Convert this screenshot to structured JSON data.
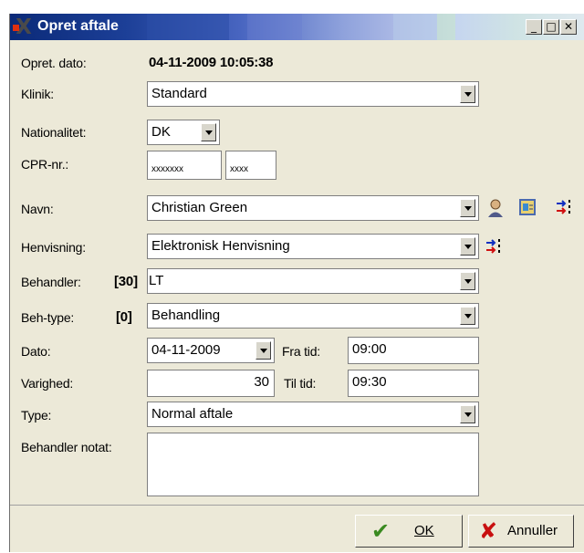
{
  "window": {
    "title": "Opret aftale"
  },
  "labels": {
    "created_date": "Opret. dato:",
    "clinic": "Klinik:",
    "nationality": "Nationalitet:",
    "cpr": "CPR-nr.:",
    "name": "Navn:",
    "referral": "Henvisning:",
    "practitioner": "Behandler:",
    "practitioner_code": "[30]",
    "treatment_type": "Beh-type:",
    "treatment_type_code": "[0]",
    "date": "Dato:",
    "from_time": "Fra tid:",
    "duration": "Varighed:",
    "to_time": "Til tid:",
    "type": "Type:",
    "practitioner_note": "Behandler notat:"
  },
  "values": {
    "created_date": "04-11-2009 10:05:38",
    "clinic": "Standard",
    "nationality": "DK",
    "cpr_first": "xxxxxxx",
    "cpr_second": "xxxx",
    "name": "Christian Green",
    "referral": "Elektronisk Henvisning",
    "practitioner": "LT",
    "treatment_type": "Behandling",
    "date": "04-11-2009",
    "from_time": "09:00",
    "duration": "30",
    "to_time": "09:30",
    "type": "Normal aftale",
    "practitioner_note": ""
  },
  "buttons": {
    "ok": "OK",
    "cancel": "Annuller"
  },
  "icons": [
    "person-icon",
    "card-icon",
    "transfer-icon",
    "transfer-icon"
  ]
}
